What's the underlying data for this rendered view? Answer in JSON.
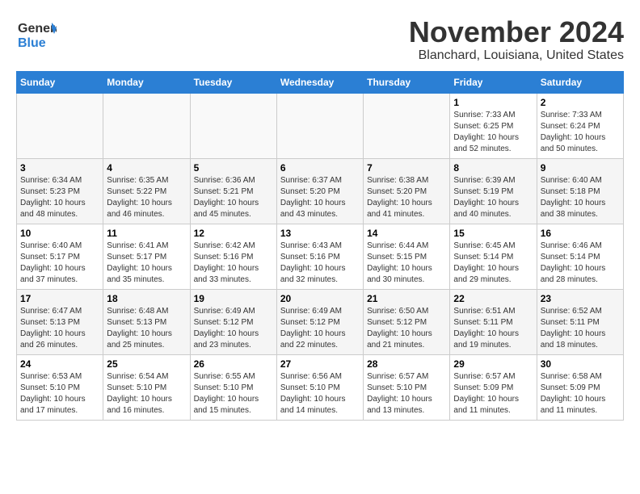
{
  "logo": {
    "line1": "General",
    "line2": "Blue"
  },
  "title": "November 2024",
  "subtitle": "Blanchard, Louisiana, United States",
  "weekdays": [
    "Sunday",
    "Monday",
    "Tuesday",
    "Wednesday",
    "Thursday",
    "Friday",
    "Saturday"
  ],
  "weeks": [
    [
      {
        "day": "",
        "sunrise": "",
        "sunset": "",
        "daylight": ""
      },
      {
        "day": "",
        "sunrise": "",
        "sunset": "",
        "daylight": ""
      },
      {
        "day": "",
        "sunrise": "",
        "sunset": "",
        "daylight": ""
      },
      {
        "day": "",
        "sunrise": "",
        "sunset": "",
        "daylight": ""
      },
      {
        "day": "",
        "sunrise": "",
        "sunset": "",
        "daylight": ""
      },
      {
        "day": "1",
        "sunrise": "Sunrise: 7:33 AM",
        "sunset": "Sunset: 6:25 PM",
        "daylight": "Daylight: 10 hours and 52 minutes."
      },
      {
        "day": "2",
        "sunrise": "Sunrise: 7:33 AM",
        "sunset": "Sunset: 6:24 PM",
        "daylight": "Daylight: 10 hours and 50 minutes."
      }
    ],
    [
      {
        "day": "3",
        "sunrise": "Sunrise: 6:34 AM",
        "sunset": "Sunset: 5:23 PM",
        "daylight": "Daylight: 10 hours and 48 minutes."
      },
      {
        "day": "4",
        "sunrise": "Sunrise: 6:35 AM",
        "sunset": "Sunset: 5:22 PM",
        "daylight": "Daylight: 10 hours and 46 minutes."
      },
      {
        "day": "5",
        "sunrise": "Sunrise: 6:36 AM",
        "sunset": "Sunset: 5:21 PM",
        "daylight": "Daylight: 10 hours and 45 minutes."
      },
      {
        "day": "6",
        "sunrise": "Sunrise: 6:37 AM",
        "sunset": "Sunset: 5:20 PM",
        "daylight": "Daylight: 10 hours and 43 minutes."
      },
      {
        "day": "7",
        "sunrise": "Sunrise: 6:38 AM",
        "sunset": "Sunset: 5:20 PM",
        "daylight": "Daylight: 10 hours and 41 minutes."
      },
      {
        "day": "8",
        "sunrise": "Sunrise: 6:39 AM",
        "sunset": "Sunset: 5:19 PM",
        "daylight": "Daylight: 10 hours and 40 minutes."
      },
      {
        "day": "9",
        "sunrise": "Sunrise: 6:40 AM",
        "sunset": "Sunset: 5:18 PM",
        "daylight": "Daylight: 10 hours and 38 minutes."
      }
    ],
    [
      {
        "day": "10",
        "sunrise": "Sunrise: 6:40 AM",
        "sunset": "Sunset: 5:17 PM",
        "daylight": "Daylight: 10 hours and 37 minutes."
      },
      {
        "day": "11",
        "sunrise": "Sunrise: 6:41 AM",
        "sunset": "Sunset: 5:17 PM",
        "daylight": "Daylight: 10 hours and 35 minutes."
      },
      {
        "day": "12",
        "sunrise": "Sunrise: 6:42 AM",
        "sunset": "Sunset: 5:16 PM",
        "daylight": "Daylight: 10 hours and 33 minutes."
      },
      {
        "day": "13",
        "sunrise": "Sunrise: 6:43 AM",
        "sunset": "Sunset: 5:16 PM",
        "daylight": "Daylight: 10 hours and 32 minutes."
      },
      {
        "day": "14",
        "sunrise": "Sunrise: 6:44 AM",
        "sunset": "Sunset: 5:15 PM",
        "daylight": "Daylight: 10 hours and 30 minutes."
      },
      {
        "day": "15",
        "sunrise": "Sunrise: 6:45 AM",
        "sunset": "Sunset: 5:14 PM",
        "daylight": "Daylight: 10 hours and 29 minutes."
      },
      {
        "day": "16",
        "sunrise": "Sunrise: 6:46 AM",
        "sunset": "Sunset: 5:14 PM",
        "daylight": "Daylight: 10 hours and 28 minutes."
      }
    ],
    [
      {
        "day": "17",
        "sunrise": "Sunrise: 6:47 AM",
        "sunset": "Sunset: 5:13 PM",
        "daylight": "Daylight: 10 hours and 26 minutes."
      },
      {
        "day": "18",
        "sunrise": "Sunrise: 6:48 AM",
        "sunset": "Sunset: 5:13 PM",
        "daylight": "Daylight: 10 hours and 25 minutes."
      },
      {
        "day": "19",
        "sunrise": "Sunrise: 6:49 AM",
        "sunset": "Sunset: 5:12 PM",
        "daylight": "Daylight: 10 hours and 23 minutes."
      },
      {
        "day": "20",
        "sunrise": "Sunrise: 6:49 AM",
        "sunset": "Sunset: 5:12 PM",
        "daylight": "Daylight: 10 hours and 22 minutes."
      },
      {
        "day": "21",
        "sunrise": "Sunrise: 6:50 AM",
        "sunset": "Sunset: 5:12 PM",
        "daylight": "Daylight: 10 hours and 21 minutes."
      },
      {
        "day": "22",
        "sunrise": "Sunrise: 6:51 AM",
        "sunset": "Sunset: 5:11 PM",
        "daylight": "Daylight: 10 hours and 19 minutes."
      },
      {
        "day": "23",
        "sunrise": "Sunrise: 6:52 AM",
        "sunset": "Sunset: 5:11 PM",
        "daylight": "Daylight: 10 hours and 18 minutes."
      }
    ],
    [
      {
        "day": "24",
        "sunrise": "Sunrise: 6:53 AM",
        "sunset": "Sunset: 5:10 PM",
        "daylight": "Daylight: 10 hours and 17 minutes."
      },
      {
        "day": "25",
        "sunrise": "Sunrise: 6:54 AM",
        "sunset": "Sunset: 5:10 PM",
        "daylight": "Daylight: 10 hours and 16 minutes."
      },
      {
        "day": "26",
        "sunrise": "Sunrise: 6:55 AM",
        "sunset": "Sunset: 5:10 PM",
        "daylight": "Daylight: 10 hours and 15 minutes."
      },
      {
        "day": "27",
        "sunrise": "Sunrise: 6:56 AM",
        "sunset": "Sunset: 5:10 PM",
        "daylight": "Daylight: 10 hours and 14 minutes."
      },
      {
        "day": "28",
        "sunrise": "Sunrise: 6:57 AM",
        "sunset": "Sunset: 5:10 PM",
        "daylight": "Daylight: 10 hours and 13 minutes."
      },
      {
        "day": "29",
        "sunrise": "Sunrise: 6:57 AM",
        "sunset": "Sunset: 5:09 PM",
        "daylight": "Daylight: 10 hours and 11 minutes."
      },
      {
        "day": "30",
        "sunrise": "Sunrise: 6:58 AM",
        "sunset": "Sunset: 5:09 PM",
        "daylight": "Daylight: 10 hours and 11 minutes."
      }
    ]
  ]
}
